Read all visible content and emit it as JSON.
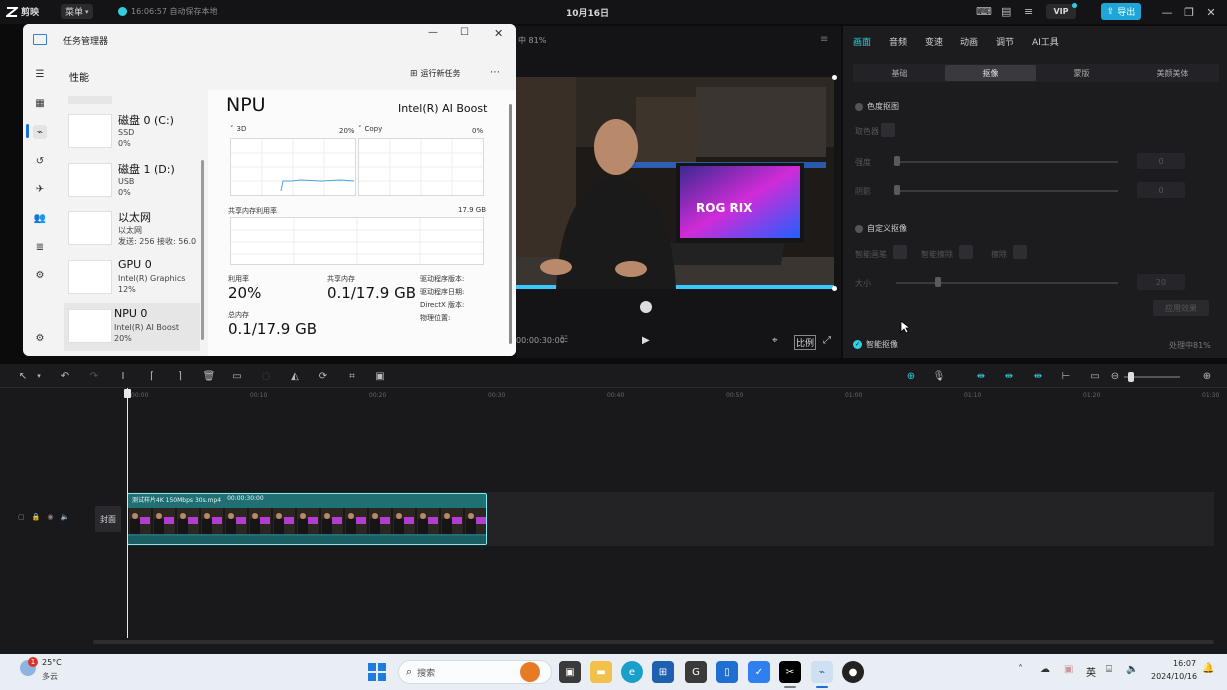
{
  "topbar": {
    "app_name": "剪映",
    "menu_label": "菜单",
    "autosave_text": "16:06:57 自动保存本地",
    "project_title": "10月16日",
    "vip_label": "VIP",
    "export_label": "导出"
  },
  "player": {
    "header_text": "中 81%",
    "timecode": "00:00:30:00",
    "ratio_label": "比例"
  },
  "right_panel": {
    "tabs": [
      "画面",
      "音频",
      "变速",
      "动画",
      "调节",
      "AI工具"
    ],
    "active_tab": "画面",
    "subtabs": [
      "基础",
      "抠像",
      "蒙版",
      "美颜美体"
    ],
    "active_subtab": "抠像",
    "chroma_key_label": "色度抠图",
    "color_picker_label": "取色器",
    "intensity_label": "强度",
    "shadow_label": "阴影",
    "intensity_value": "0",
    "shadow_value": "0",
    "custom_cutout_label": "自定义抠像",
    "smart_brush_label": "智能画笔",
    "smart_erase_label": "智能擦除",
    "erase_label": "擦除",
    "size_label": "大小",
    "size_value": "20",
    "apply_label": "应用效果",
    "smart_cutout_label": "智能抠像",
    "processing_text": "处理中81%"
  },
  "taskmanager": {
    "title": "任务管理器",
    "section": "性能",
    "run_task_label": "运行新任务",
    "devices": [
      {
        "name": "磁盘 0 (C:)",
        "line1": "SSD",
        "line2": "0%"
      },
      {
        "name": "磁盘 1 (D:)",
        "line1": "USB",
        "line2": "0%"
      },
      {
        "name": "以太网",
        "line1": "以太网",
        "line2": "发送: 256 接收: 56.0"
      },
      {
        "name": "GPU 0",
        "line1": "Intel(R) Graphics",
        "line2": "12%"
      },
      {
        "name": "NPU 0",
        "line1": "Intel(R) AI Boost",
        "line2": "20%"
      }
    ],
    "npu_title": "NPU",
    "npu_device": "Intel(R) AI Boost",
    "graph1_label": "3D",
    "graph1_pct": "20%",
    "graph2_label": "Copy",
    "graph2_pct": "0%",
    "shared_mem_label": "共享内存利用率",
    "shared_mem_max": "17.9 GB",
    "util_label": "利用率",
    "util_value": "20%",
    "shared_label": "共享内存",
    "shared_value": "0.1/17.9 GB",
    "total_label": "总内存",
    "total_value": "0.1/17.9 GB",
    "driver_version_label": "驱动程序版本:",
    "driver_date_label": "驱动程序日期:",
    "directx_label": "DirectX 版本:",
    "physical_label": "物理位置:"
  },
  "timeline": {
    "ticks": [
      "00:00",
      "00:10",
      "00:20",
      "00:30",
      "00:40",
      "00:50",
      "01:00",
      "01:10",
      "01:20",
      "01:30"
    ],
    "clip_label": "测试样片4K 150Mbps 30s.mp4",
    "clip_duration": "00:00:30:00",
    "cover_label": "封面"
  },
  "taskbar": {
    "weather_temp": "25°C",
    "weather_desc": "多云",
    "search_placeholder": "搜索",
    "ime_label": "英",
    "time": "16:07",
    "date": "2024/10/16",
    "notification_badge": "1"
  },
  "colors": {
    "accent": "#2fd1e0",
    "export_bg": "#1ea6d8",
    "clip_bg": "#1f6f73"
  }
}
